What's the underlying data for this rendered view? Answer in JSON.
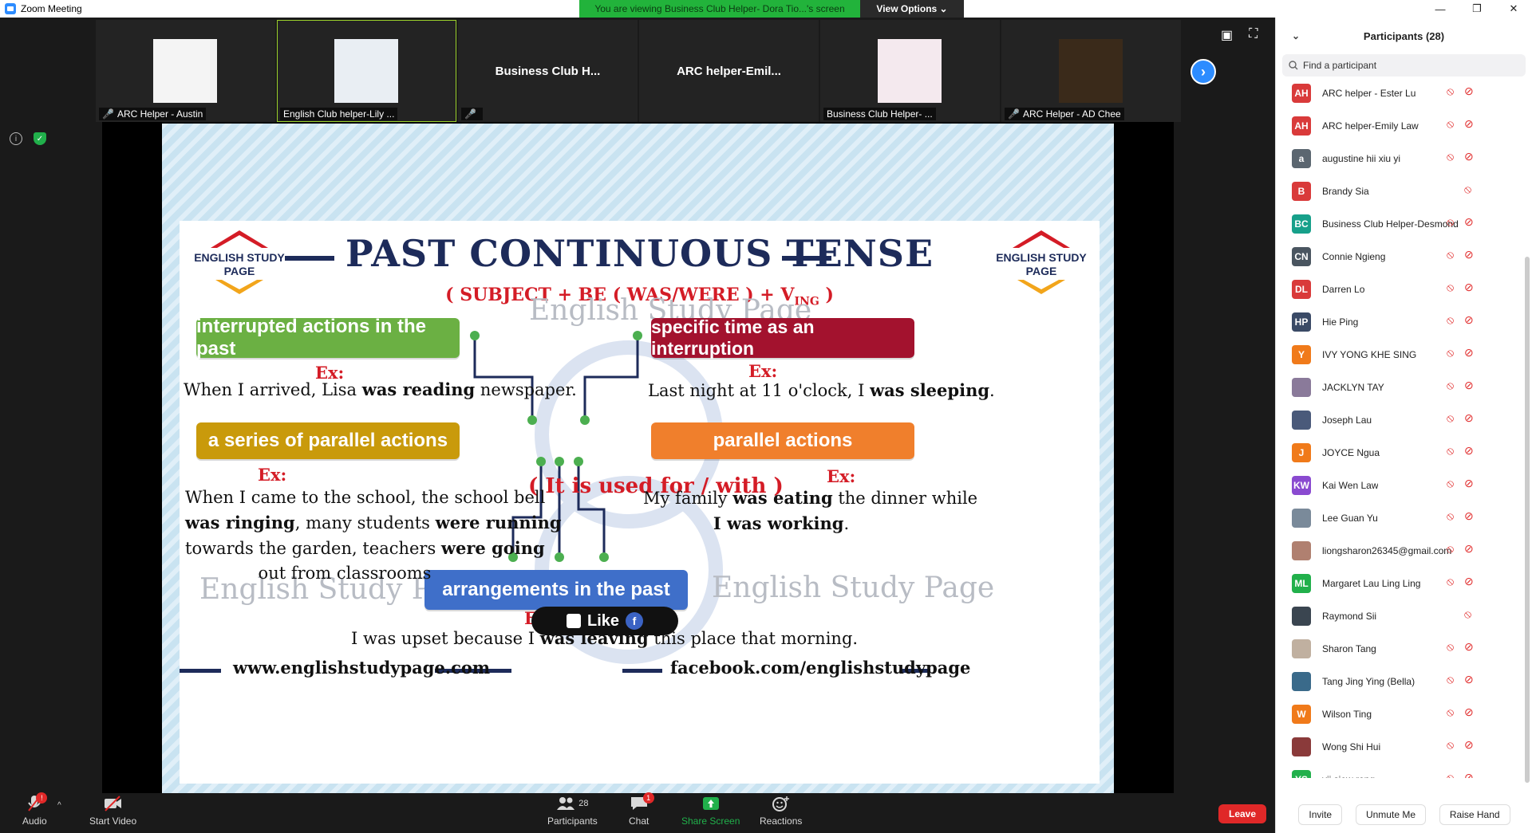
{
  "window": {
    "title": "Zoom Meeting"
  },
  "banner": {
    "viewing_text": "You are viewing Business Club Helper- Dora Tio...'s screen",
    "view_options": "View Options ⌄"
  },
  "video_strip": [
    {
      "name": "ARC Helper - Austin",
      "muted": true,
      "type": "photo",
      "color": "#f4f4f4"
    },
    {
      "name": "English Club helper-Lily ...",
      "muted": false,
      "type": "photo",
      "color": "#e9eef3",
      "active": true
    },
    {
      "name": "",
      "bigname": "Business Club H...",
      "muted": true,
      "type": "name"
    },
    {
      "name": "",
      "bigname": "ARC  helper-Emil...",
      "muted": false,
      "type": "name"
    },
    {
      "name": "Business Club Helper- ...",
      "muted": false,
      "type": "photo",
      "color": "#f4e9ee"
    },
    {
      "name": "ARC Helper - AD Chee",
      "muted": true,
      "type": "photo",
      "color": "#3a2a1a"
    }
  ],
  "slide": {
    "title": "PAST CONTINUOUS TENSE",
    "formula": "( SUBJECT + BE ( WAS/WERE ) + VING )",
    "logo_text_1": "ENGLISH STUDY",
    "logo_text_2": "PAGE",
    "watermark": "English Study Page",
    "center_label": "( It is used for / with )",
    "ex_label": "Ex:",
    "boxes": {
      "interrupted": "interrupted actions in the past",
      "specific_time": "specific time as an interruption",
      "series": "a series of parallel actions",
      "parallel": "parallel actions",
      "arrangements": "arrangements in the past"
    },
    "examples": {
      "interrupted_a": "When I arrived, Lisa ",
      "interrupted_b": "was reading",
      "interrupted_c": " newspaper.",
      "specific_a": "Last night at 11 o'clock, I ",
      "specific_b": "was sleeping",
      "specific_c": ".",
      "series_l1": "When I came to the school, the school bell",
      "series_l2_b": "was ringing",
      "series_l2_a": ", many students ",
      "series_l2_c": "were running",
      "series_l3_a": "towards the garden, teachers ",
      "series_l3_b": "were going",
      "series_l4": "out from classrooms",
      "parallel_l1_a": "My family ",
      "parallel_l1_b": "was eating",
      "parallel_l1_c": " the dinner while",
      "parallel_l2": "I was working",
      "parallel_l2_c": ".",
      "arr_a": "I was upset because I ",
      "arr_b": "was leaving",
      "arr_c": " this place that morning."
    },
    "footer_left": "www.englishstudypage.com",
    "footer_right": "facebook.com/englishstudypage",
    "like": "Like"
  },
  "toolbar": {
    "audio": "Audio",
    "audio_badge": "!",
    "video": "Start Video",
    "participants": "Participants",
    "participants_count": "28",
    "chat": "Chat",
    "chat_badge": "1",
    "share": "Share Screen",
    "reactions": "Reactions",
    "leave": "Leave"
  },
  "panel": {
    "title": "Participants (28)",
    "search_placeholder": "Find a participant",
    "participants": [
      {
        "initials": "AH",
        "name": "ARC helper - Ester Lu",
        "color": "#d93a3a",
        "video": true
      },
      {
        "initials": "AH",
        "name": "ARC helper-Emily Law",
        "color": "#d93a3a",
        "video": true
      },
      {
        "initials": "a",
        "name": "augustine hii xiu yi",
        "color": "#5b6670",
        "video": true
      },
      {
        "initials": "B",
        "name": "Brandy Sia",
        "color": "#d93a3a",
        "video": false
      },
      {
        "initials": "BC",
        "name": "Business Club Helper-Desmond",
        "color": "#17a08a",
        "video": true
      },
      {
        "initials": "CN",
        "name": "Connie Ngieng",
        "color": "#4a5560",
        "video": true
      },
      {
        "initials": "DL",
        "name": "Darren Lo",
        "color": "#d93a3a",
        "video": true
      },
      {
        "initials": "HP",
        "name": "Hie Ping",
        "color": "#3a4a66",
        "video": true
      },
      {
        "initials": "Y",
        "name": "IVY YONG KHE SING",
        "color": "#f07a1a",
        "video": true
      },
      {
        "initials": "",
        "name": "JACKLYN TAY",
        "color": "#8a7a9a",
        "video": true
      },
      {
        "initials": "",
        "name": "Joseph Lau",
        "color": "#4a5a7a",
        "video": true
      },
      {
        "initials": "J",
        "name": "JOYCE Ngua",
        "color": "#f07a1a",
        "video": true
      },
      {
        "initials": "KW",
        "name": "Kai Wen Law",
        "color": "#8a4ad0",
        "video": true
      },
      {
        "initials": "",
        "name": "Lee Guan Yu",
        "color": "#7a8a9a",
        "video": true
      },
      {
        "initials": "",
        "name": "liongsharon26345@gmail.com",
        "color": "#b08070",
        "video": true
      },
      {
        "initials": "ML",
        "name": "Margaret Lau Ling Ling",
        "color": "#21b04b",
        "video": true
      },
      {
        "initials": "",
        "name": "Raymond Sii",
        "color": "#3a4550",
        "video": false
      },
      {
        "initials": "",
        "name": "Sharon Tang",
        "color": "#c0b0a0",
        "video": true
      },
      {
        "initials": "",
        "name": "Tang Jing Ying (Bella)",
        "color": "#3a6a8a",
        "video": true
      },
      {
        "initials": "W",
        "name": "Wilson Ting",
        "color": "#f07a1a",
        "video": true
      },
      {
        "initials": "",
        "name": "Wong Shi Hui",
        "color": "#8a3a3a",
        "video": true
      },
      {
        "initials": "YS",
        "name": "yii siew rong",
        "color": "#21b04b",
        "video": true
      }
    ],
    "invite": "Invite",
    "unmute": "Unmute Me",
    "raise_hand": "Raise Hand"
  }
}
